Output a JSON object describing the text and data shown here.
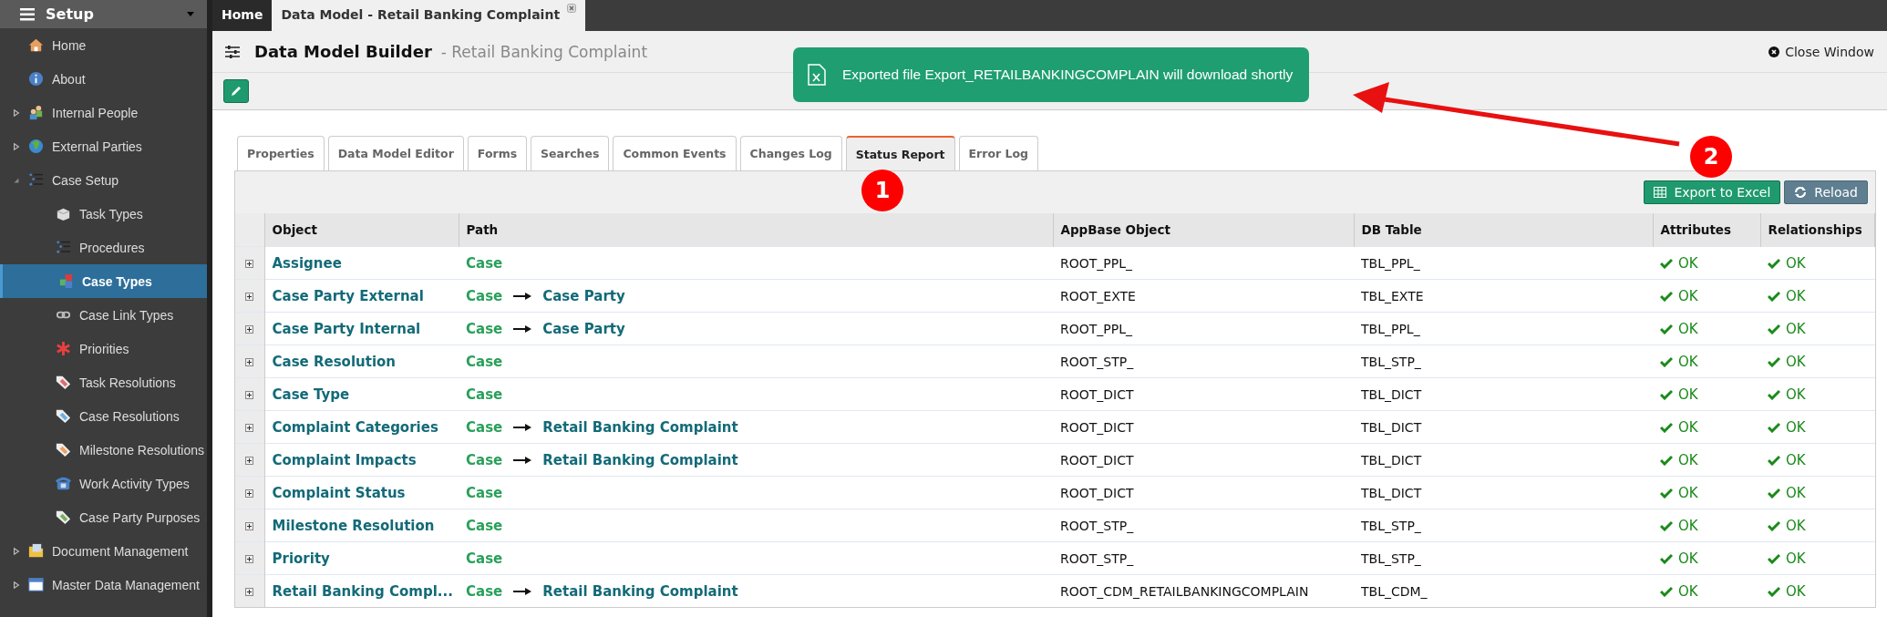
{
  "sidebar": {
    "title": "Setup",
    "items": [
      {
        "label": "Home",
        "selected": false
      },
      {
        "label": "About",
        "selected": false
      },
      {
        "label": "Internal People",
        "selected": false,
        "expanded": false
      },
      {
        "label": "External Parties",
        "selected": false,
        "expanded": false
      },
      {
        "label": "Case Setup",
        "selected": false,
        "expanded": true,
        "children": [
          {
            "label": "Task Types",
            "selected": false
          },
          {
            "label": "Procedures",
            "selected": false
          },
          {
            "label": "Case Types",
            "selected": true
          },
          {
            "label": "Case Link Types",
            "selected": false
          },
          {
            "label": "Priorities",
            "selected": false
          },
          {
            "label": "Task Resolutions",
            "selected": false
          },
          {
            "label": "Case Resolutions",
            "selected": false
          },
          {
            "label": "Milestone Resolutions",
            "selected": false
          },
          {
            "label": "Work Activity Types",
            "selected": false
          },
          {
            "label": "Case Party Purposes",
            "selected": false
          }
        ]
      },
      {
        "label": "Document Management",
        "selected": false,
        "expanded": false
      },
      {
        "label": "Master Data Management",
        "selected": false,
        "expanded": false
      }
    ]
  },
  "window_tabs": [
    {
      "label": "Home",
      "selected": false
    },
    {
      "label": "Data Model - Retail Banking Complaint",
      "selected": true,
      "closable": true
    }
  ],
  "header": {
    "title": "Data Model Builder",
    "subtitle": "- Retail Banking Complaint",
    "close": "Close Window"
  },
  "toast": {
    "message": "Exported file Export_RETAILBANKINGCOMPLAIN will download shortly"
  },
  "tabs": [
    {
      "label": "Properties",
      "selected": false
    },
    {
      "label": "Data Model Editor",
      "selected": false
    },
    {
      "label": "Forms",
      "selected": false
    },
    {
      "label": "Searches",
      "selected": false
    },
    {
      "label": "Common Events",
      "selected": false
    },
    {
      "label": "Changes Log",
      "selected": false
    },
    {
      "label": "Status Report",
      "selected": true
    },
    {
      "label": "Error Log",
      "selected": false
    }
  ],
  "toolbar": {
    "export": "Export to Excel",
    "reload": "Reload"
  },
  "table": {
    "columns": [
      "Object",
      "Path",
      "AppBase Object",
      "DB Table",
      "Attributes",
      "Relationships"
    ],
    "rows": [
      {
        "object": "Assignee",
        "path": [
          "Case"
        ],
        "appbase": "ROOT_PPL_",
        "db_table": "TBL_PPL_",
        "attributes": "OK",
        "relationships": "OK"
      },
      {
        "object": "Case Party External",
        "path": [
          "Case",
          "Case Party"
        ],
        "appbase": "ROOT_EXTE",
        "db_table": "TBL_EXTE",
        "attributes": "OK",
        "relationships": "OK"
      },
      {
        "object": "Case Party Internal",
        "path": [
          "Case",
          "Case Party"
        ],
        "appbase": "ROOT_PPL_",
        "db_table": "TBL_PPL_",
        "attributes": "OK",
        "relationships": "OK"
      },
      {
        "object": "Case Resolution",
        "path": [
          "Case"
        ],
        "appbase": "ROOT_STP_",
        "db_table": "TBL_STP_",
        "attributes": "OK",
        "relationships": "OK"
      },
      {
        "object": "Case Type",
        "path": [
          "Case"
        ],
        "appbase": "ROOT_DICT",
        "db_table": "TBL_DICT",
        "attributes": "OK",
        "relationships": "OK"
      },
      {
        "object": "Complaint Categories",
        "path": [
          "Case",
          "Retail Banking Complaint"
        ],
        "appbase": "ROOT_DICT",
        "db_table": "TBL_DICT",
        "attributes": "OK",
        "relationships": "OK"
      },
      {
        "object": "Complaint Impacts",
        "path": [
          "Case",
          "Retail Banking Complaint"
        ],
        "appbase": "ROOT_DICT",
        "db_table": "TBL_DICT",
        "attributes": "OK",
        "relationships": "OK"
      },
      {
        "object": "Complaint Status",
        "path": [
          "Case"
        ],
        "appbase": "ROOT_DICT",
        "db_table": "TBL_DICT",
        "attributes": "OK",
        "relationships": "OK"
      },
      {
        "object": "Milestone Resolution",
        "path": [
          "Case"
        ],
        "appbase": "ROOT_STP_",
        "db_table": "TBL_STP_",
        "attributes": "OK",
        "relationships": "OK"
      },
      {
        "object": "Priority",
        "path": [
          "Case"
        ],
        "appbase": "ROOT_STP_",
        "db_table": "TBL_STP_",
        "attributes": "OK",
        "relationships": "OK"
      },
      {
        "object": "Retail Banking Compl...",
        "path": [
          "Case",
          "Retail Banking Complaint"
        ],
        "appbase": "ROOT_CDM_RETAILBANKINGCOMPLAIN",
        "db_table": "TBL_CDM_",
        "attributes": "OK",
        "relationships": "OK"
      }
    ]
  },
  "annotations": [
    {
      "label": "1"
    },
    {
      "label": "2"
    }
  ]
}
